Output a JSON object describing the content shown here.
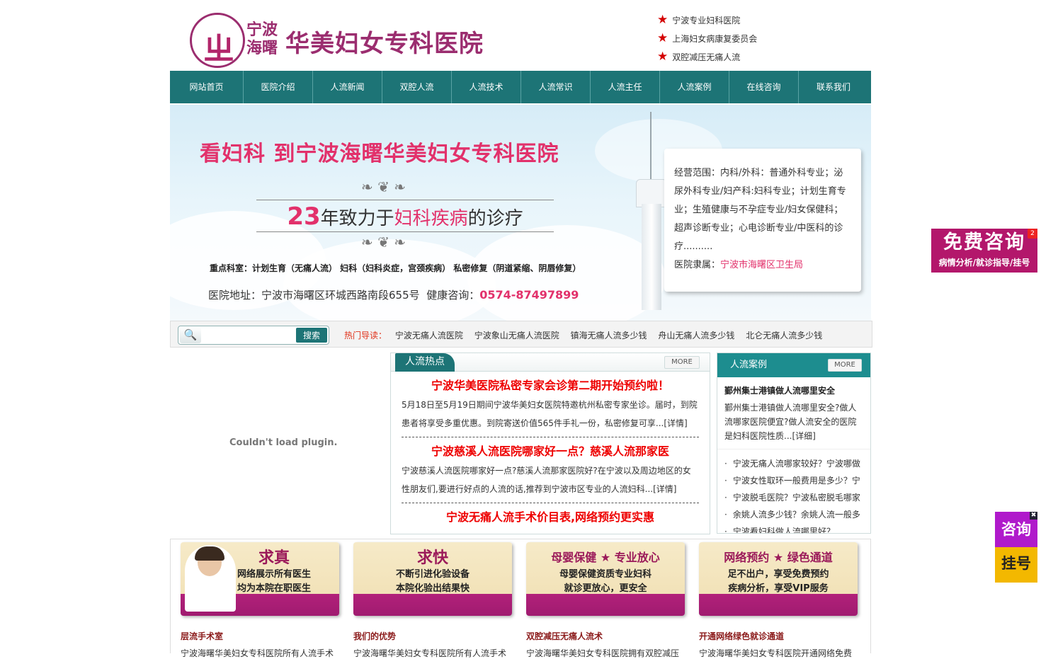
{
  "header": {
    "logo_city": "宁波海曙",
    "logo_name": "华美妇女专科医院",
    "tags": [
      "宁波专业妇科医院",
      "上海妇女病康复委员会",
      "双腔减压无痛人流"
    ]
  },
  "nav": [
    "网站首页",
    "医院介绍",
    "人流新闻",
    "双腔人流",
    "人流技术",
    "人流常识",
    "人流主任",
    "人流案例",
    "在线咨询",
    "联系我们"
  ],
  "banner": {
    "headline": "看妇科 到宁波海曙华美妇女专科医院",
    "years_num": "23",
    "years_pre": "年致力于",
    "years_hl": "妇科疾病",
    "years_post": "的诊疗",
    "key_dept": "重点科室：计划生育（无痛人流） 妇科（妇科炎症，宫颈疾病） 私密修复（阴道紧缩、阴唇修复）",
    "address": "医院地址：宁波市海曙区环城西路南段655号",
    "phone_label": "健康咨询：",
    "phone": "0574-87497899",
    "scope": "经营范围：内科/外科：普通外科专业；泌尿外科专业/妇产科:妇科专业；计划生育专业；生殖健康与不孕症专业/妇女保健科；超声诊断专业；心电诊断专业/中医科的诊疗..........",
    "belong_label": "医院隶属：",
    "belong": "宁波市海曙区卫生局"
  },
  "search": {
    "placeholder": "",
    "button": "搜索",
    "hot_label": "热门导读：",
    "hot_links": [
      "宁波无痛人流医院",
      "宁波象山无痛人流医院",
      "镇海无痛人流多少钱",
      "舟山无痛人流多少钱",
      "北仑无痛人流多少钱"
    ]
  },
  "plugin": {
    "message": "Couldn't load plugin."
  },
  "news": {
    "tab": "人流热点",
    "more": "MORE",
    "items": [
      {
        "title": "宁波华美医院私密专家会诊第二期开始预约啦！",
        "desc": "5月18日至5月19日期间宁波华美妇女医院特邀杭州私密专家坐诊。届时，到院患者将享受多重优惠。到院寄送价值565件手礼一份，私密修复可享...",
        "link": "[详情]"
      },
      {
        "title": "宁波慈溪人流医院哪家好一点？慈溪人流那家医",
        "desc": "宁波慈溪人流医院哪家好一点?慈溪人流那家医院好?在宁波以及周边地区的女性朋友们,要进行好点的人流的话,推荐到宁波市区专业的人流妇科...",
        "link": "[详情]"
      },
      {
        "title": "宁波无痛人流手术价目表,网络预约更实惠",
        "desc": "",
        "link": ""
      }
    ]
  },
  "cases": {
    "title": "人流案例",
    "more": "MORE",
    "lead_title": "鄞州集士港镇做人流哪里安全",
    "lead_desc": "鄞州集士港镇做人流哪里安全?做人流哪家医院便宜?做人流安全的医院是妇科医院性质...",
    "lead_link": "[详细]",
    "list": [
      "宁波无痛人流哪家较好？宁波哪做",
      "宁波女性取环一般费用是多少？宁",
      "宁波脱毛医院？宁波私密脱毛哪家",
      "余姚人流多少钱？余姚人流一般多",
      "宁波看妇科做人流哪里好？"
    ]
  },
  "promos": [
    {
      "big": "求真",
      "lines": [
        "网络展示所有医生",
        "均为本院在职医生"
      ],
      "sec_title": "层流手术室",
      "sec_text": "宁波海曙华美妇女专科医院所有人流手术"
    },
    {
      "big": "求快",
      "lines": [
        "不断引进化验设备",
        "本院化验出结果快"
      ],
      "sec_title": "我们的优势",
      "sec_text": "宁波海曙华美妇女专科医院所有人流手术"
    },
    {
      "big": "母婴保健 ★ 专业放心",
      "lines": [
        "母婴保健资质专业妇科",
        "就诊更放心，更安全"
      ],
      "sec_title": "双腔减压无痛人流术",
      "sec_text": "宁波海曙华美妇女专科医院拥有双腔减压"
    },
    {
      "big": "网络预约 ★ 绿色通道",
      "lines": [
        "足不出户，享受免费预约",
        "疾病分析，享受VIP服务"
      ],
      "sec_title": "开通网络绿色就诊通道",
      "sec_text": "宁波海曙华美妇女专科医院开通网络免费"
    }
  ],
  "float_consult": {
    "main": "免费咨询",
    "sub": "病情分析/就诊指导/挂号",
    "badge": "2"
  },
  "float_side": {
    "top": "咨询",
    "bottom": "挂号",
    "close": "✖"
  }
}
